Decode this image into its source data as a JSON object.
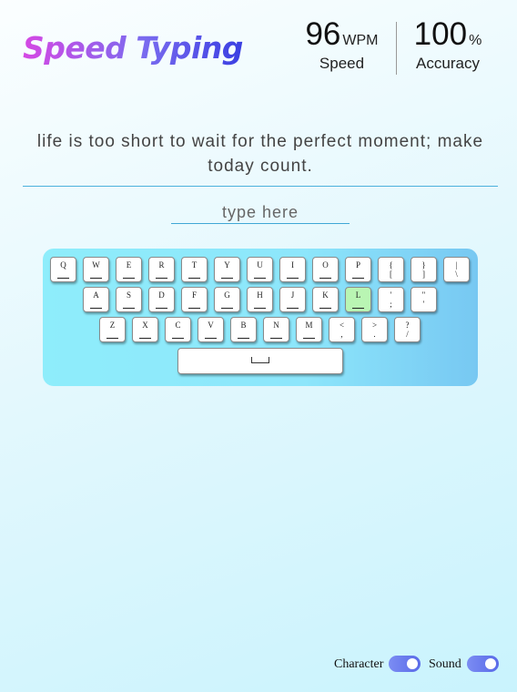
{
  "app": {
    "title": "Speed Typing"
  },
  "stats": {
    "speed": {
      "value": "96",
      "unit": "WPM",
      "label": "Speed"
    },
    "accuracy": {
      "value": "100",
      "unit": "%",
      "label": "Accuracy"
    }
  },
  "quote": {
    "text": "life is too short to wait for the perfect moment; make today count."
  },
  "input": {
    "placeholder": "type here",
    "value": ""
  },
  "keyboard": {
    "active_key": "L",
    "rows": [
      [
        {
          "top": "Q",
          "bottom": ""
        },
        {
          "top": "W",
          "bottom": ""
        },
        {
          "top": "E",
          "bottom": ""
        },
        {
          "top": "R",
          "bottom": ""
        },
        {
          "top": "T",
          "bottom": ""
        },
        {
          "top": "Y",
          "bottom": ""
        },
        {
          "top": "U",
          "bottom": ""
        },
        {
          "top": "I",
          "bottom": ""
        },
        {
          "top": "O",
          "bottom": ""
        },
        {
          "top": "P",
          "bottom": ""
        },
        {
          "top": "{",
          "bottom": "["
        },
        {
          "top": "}",
          "bottom": "]"
        },
        {
          "top": "|",
          "bottom": "\\"
        }
      ],
      [
        {
          "top": "A",
          "bottom": ""
        },
        {
          "top": "S",
          "bottom": ""
        },
        {
          "top": "D",
          "bottom": ""
        },
        {
          "top": "F",
          "bottom": ""
        },
        {
          "top": "G",
          "bottom": ""
        },
        {
          "top": "H",
          "bottom": ""
        },
        {
          "top": "J",
          "bottom": ""
        },
        {
          "top": "K",
          "bottom": ""
        },
        {
          "top": "L",
          "bottom": ""
        },
        {
          "top": "'",
          "bottom": ";"
        },
        {
          "top": "\"",
          "bottom": "'"
        }
      ],
      [
        {
          "top": "Z",
          "bottom": ""
        },
        {
          "top": "X",
          "bottom": ""
        },
        {
          "top": "C",
          "bottom": ""
        },
        {
          "top": "V",
          "bottom": ""
        },
        {
          "top": "B",
          "bottom": ""
        },
        {
          "top": "N",
          "bottom": ""
        },
        {
          "top": "M",
          "bottom": ""
        },
        {
          "top": "<",
          "bottom": ","
        },
        {
          "top": ">",
          "bottom": "."
        },
        {
          "top": "?",
          "bottom": "/"
        }
      ]
    ],
    "space_label": "space"
  },
  "settings": {
    "character": {
      "label": "Character",
      "enabled": true
    },
    "sound": {
      "label": "Sound",
      "enabled": true
    }
  },
  "colors": {
    "logo_start": "#d548e4",
    "logo_end": "#3a3fe2",
    "active_key": "#b9f5b3",
    "toggle": "#6a7cf0"
  }
}
